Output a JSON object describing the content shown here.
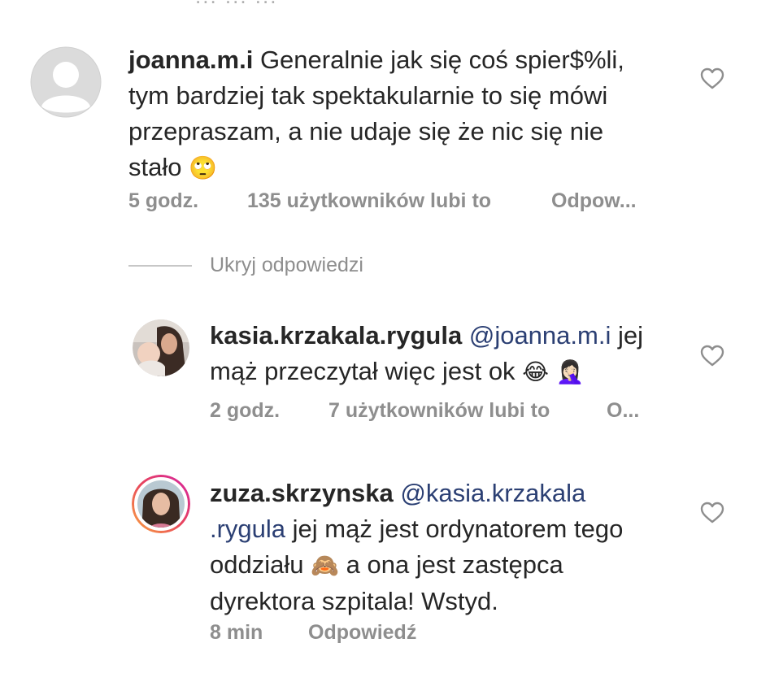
{
  "top_clipped_text": "... ... ...",
  "comments": [
    {
      "username": "joanna.m.i",
      "line1": "Generalnie jak się coś spier$%li,",
      "line2": "tym bardziej tak spektakularnie to się mówi",
      "line3": "przepraszam, a nie udaje się że nic się nie",
      "line4": "stało",
      "emoji": "🙄",
      "time": "5 godz.",
      "likes": "135 użytkowników lubi to",
      "reply": "Odpow..."
    },
    {
      "username": "kasia.krzakala.rygula",
      "mention": "@joanna.m.i",
      "line1_rest": "jej",
      "line2": "mąż przeczytał więc jest ok",
      "emoji1": "😂",
      "emoji2": "🤦🏻‍♀️",
      "time": "2 godz.",
      "likes": "7 użytkowników lubi to",
      "reply": "O..."
    },
    {
      "username": "zuza.skrzynska",
      "mention_part1": "@kasia.krzakala",
      "mention_part2": ".rygula",
      "line2_rest": "jej mąż jest ordynatorem tego",
      "line3_start": "oddziału",
      "emoji": "🙈",
      "line3_end": "a ona jest zastępca",
      "line4": "dyrektora szpitala! Wstyd.",
      "time": "8 min",
      "reply": "Odpowiedź"
    }
  ],
  "hide_replies_label": "Ukryj odpowiedzi",
  "icons": {
    "like": "heart-icon",
    "default_avatar": "default-avatar-icon"
  },
  "colors": {
    "text": "#262626",
    "meta": "#8e8e8e",
    "mention": "#2b3f73",
    "story_ring_start": "#f9a341",
    "story_ring_end": "#d6249f"
  }
}
